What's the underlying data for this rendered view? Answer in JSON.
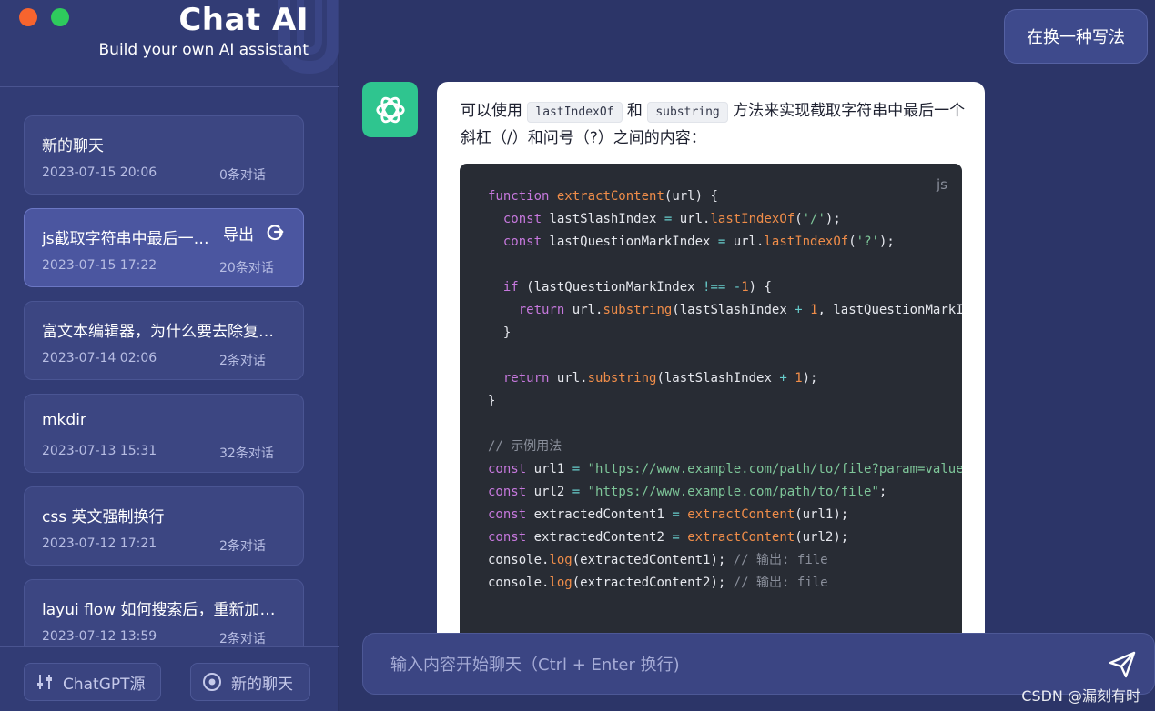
{
  "brand": {
    "title": "Chat AI",
    "subtitle": "Build your own AI assistant"
  },
  "sidebar": {
    "chats": [
      {
        "title": "新的聊天",
        "date": "2023-07-15 20:06",
        "count": "0条对话"
      },
      {
        "title": "js截取字符串中最后一个斜杠和问号之间的内容",
        "date": "2023-07-15 17:22",
        "count": "20条对话",
        "active": true,
        "export_label": "导出"
      },
      {
        "title": "富文本编辑器，为什么要去除复制的格式",
        "date": "2023-07-14 02:06",
        "count": "2条对话"
      },
      {
        "title": "mkdir",
        "date": "2023-07-13 15:31",
        "count": "32条对话"
      },
      {
        "title": "css 英文强制换行",
        "date": "2023-07-12 17:21",
        "count": "2条对话"
      },
      {
        "title": "layui flow 如何搜索后，重新加载数据",
        "date": "2023-07-12 13:59",
        "count": "2条对话"
      }
    ],
    "source_button": "ChatGPT源",
    "new_chat_button": "新的聊天"
  },
  "conversation": {
    "user_message": "在换一种写法",
    "assistant": {
      "text_before_1": "可以使用",
      "code_1": "lastIndexOf",
      "text_between": "和",
      "code_2": "substring",
      "text_after": "方法来实现截取字符串中最后一个斜杠（/）和问号（?）之间的内容：",
      "code_lang": "js"
    }
  },
  "input": {
    "placeholder": "输入内容开始聊天（Ctrl + Enter 换行)"
  },
  "watermark": "CSDN @漏刻有时",
  "colors": {
    "accent_green": "#2fc58f",
    "sidebar_bg": "#323c75",
    "main_bg": "#2c3568"
  }
}
